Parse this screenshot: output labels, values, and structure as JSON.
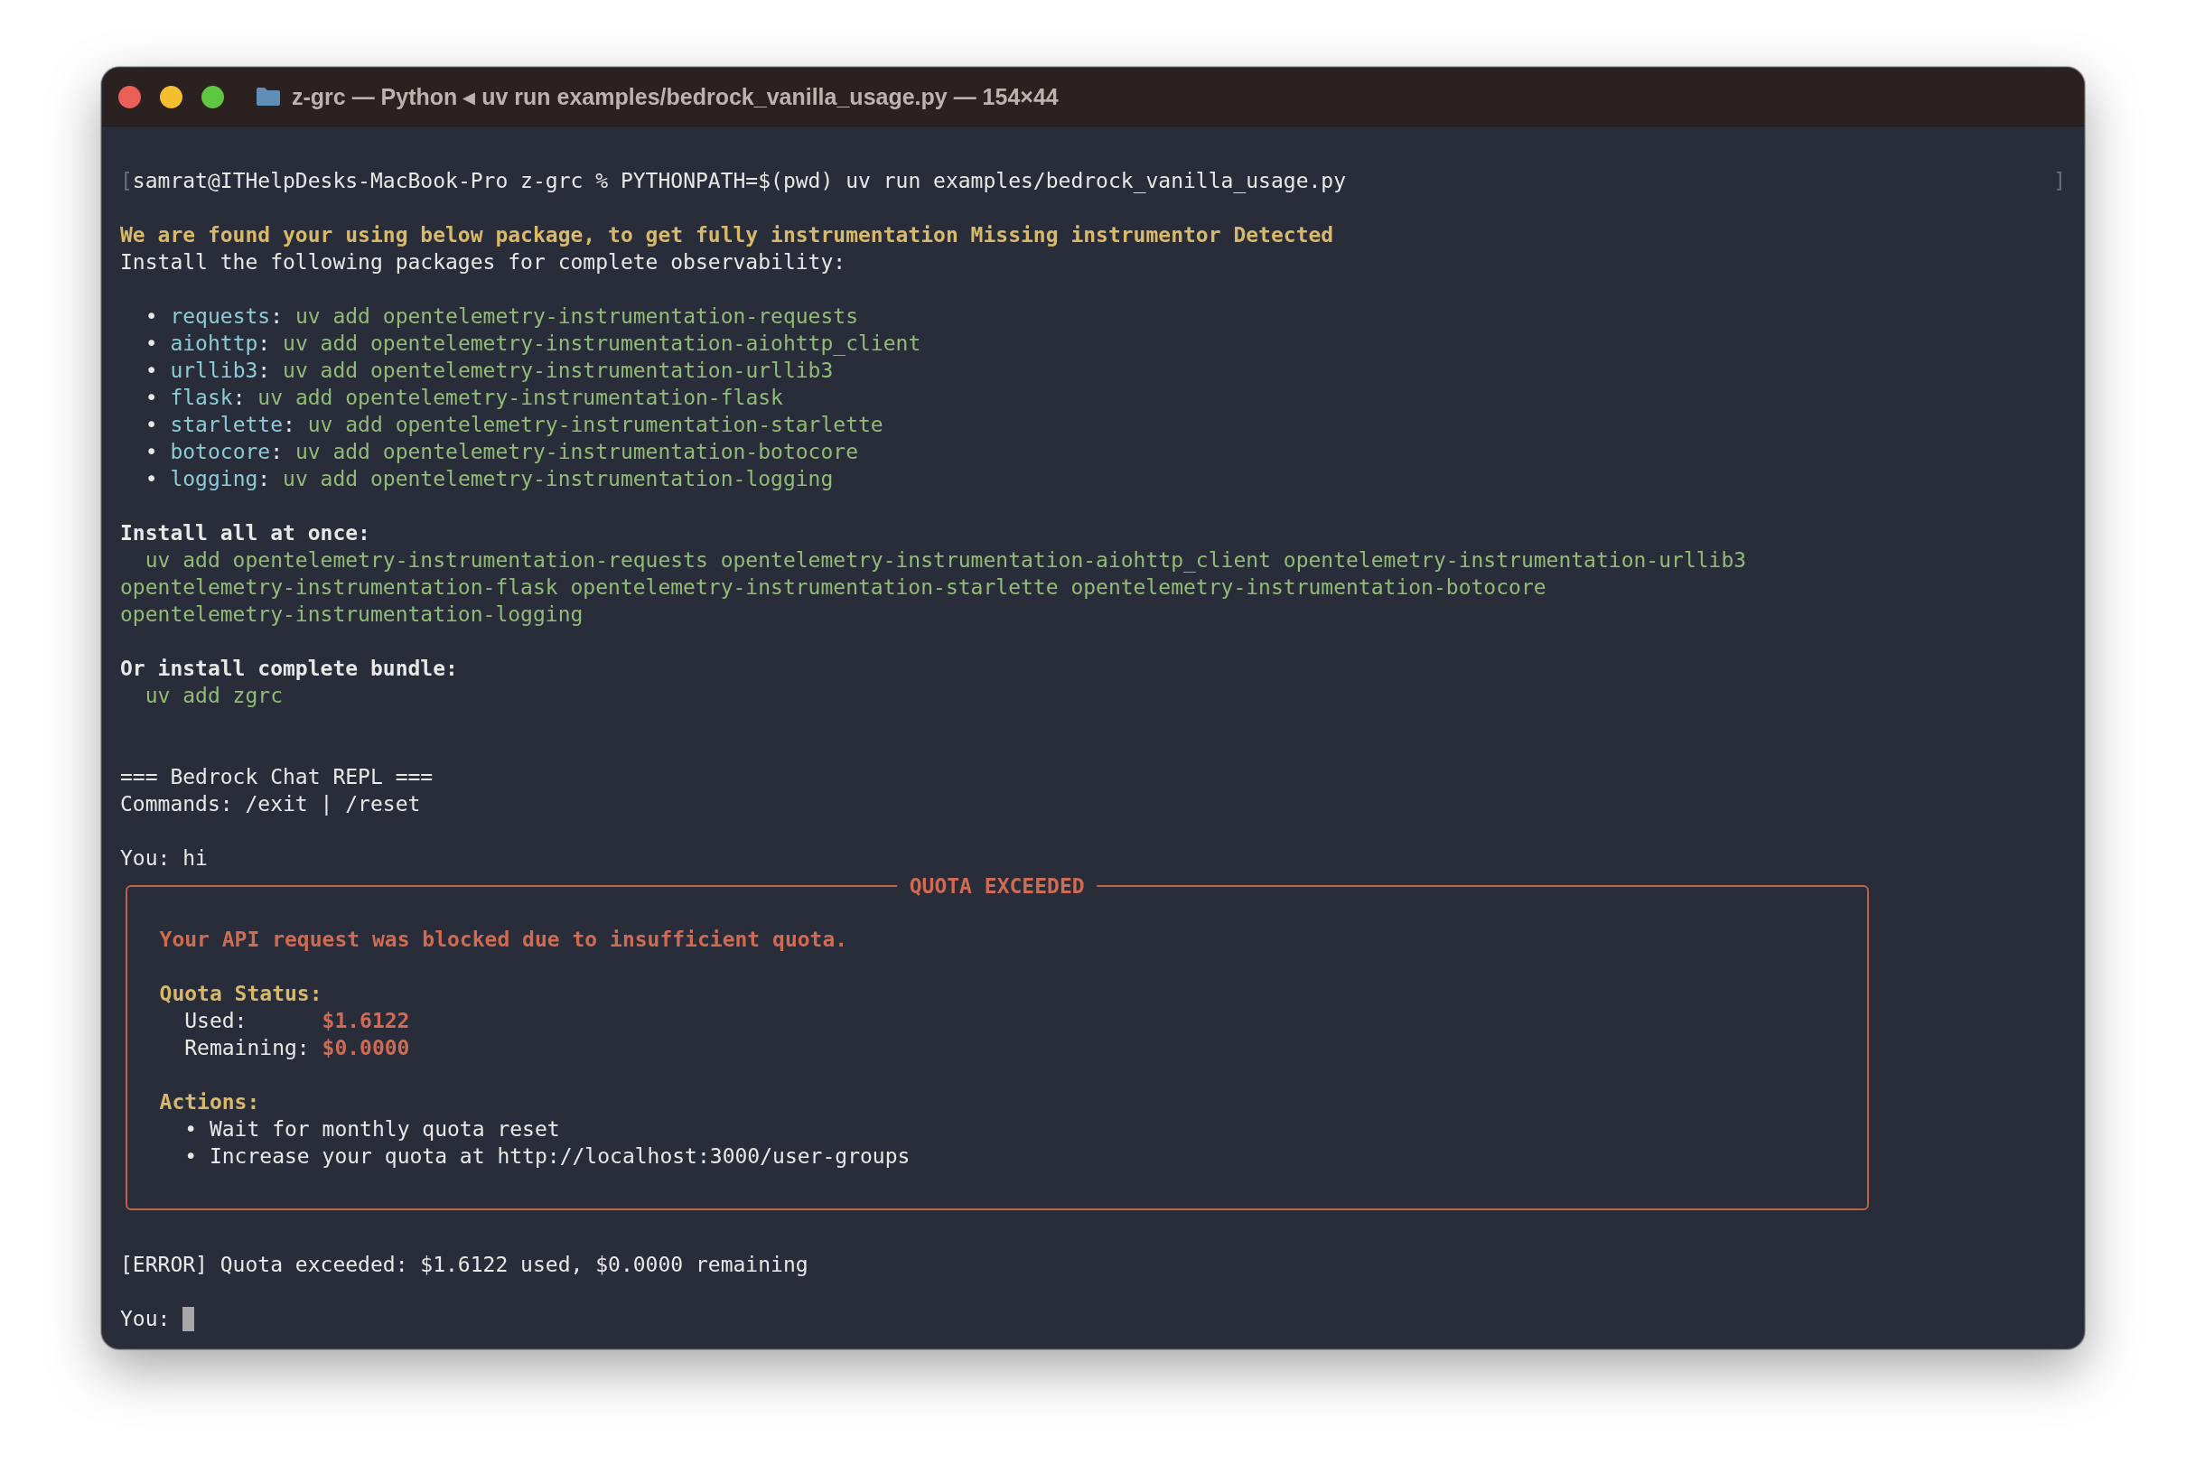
{
  "window": {
    "title": "z-grc — Python ◂ uv run examples/bedrock_vanilla_usage.py — 154×44"
  },
  "prompt": {
    "mark_left": "[",
    "command": "samrat@ITHelpDesks-MacBook-Pro z-grc % PYTHONPATH=$(pwd) uv run examples/bedrock_vanilla_usage.py",
    "mark_right": "]"
  },
  "warning": "We are found your using below package, to get fully instrumentation Missing instrumentor Detected",
  "intro": "Install the following packages for complete observability:",
  "packages": [
    {
      "marker": "•",
      "name": "requests",
      "colon": ":",
      "command": "uv add opentelemetry-instrumentation-requests"
    },
    {
      "marker": "•",
      "name": "aiohttp",
      "colon": ":",
      "command": "uv add opentelemetry-instrumentation-aiohttp_client"
    },
    {
      "marker": "•",
      "name": "urllib3",
      "colon": ":",
      "command": "uv add opentelemetry-instrumentation-urllib3"
    },
    {
      "marker": "•",
      "name": "flask",
      "colon": ":",
      "command": "uv add opentelemetry-instrumentation-flask"
    },
    {
      "marker": "•",
      "name": "starlette",
      "colon": ":",
      "command": "uv add opentelemetry-instrumentation-starlette"
    },
    {
      "marker": "•",
      "name": "botocore",
      "colon": ":",
      "command": "uv add opentelemetry-instrumentation-botocore"
    },
    {
      "marker": "•",
      "name": "logging",
      "colon": ":",
      "command": "uv add opentelemetry-instrumentation-logging"
    }
  ],
  "install_all": {
    "heading": "Install all at once:",
    "lines": [
      {
        "text": "uv add opentelemetry-instrumentation-requests opentelemetry-instrumentation-aiohttp_client opentelemetry-instrumentation-urllib3",
        "indented": true
      },
      {
        "text": "opentelemetry-instrumentation-flask opentelemetry-instrumentation-starlette opentelemetry-instrumentation-botocore",
        "indented": false
      },
      {
        "text": "opentelemetry-instrumentation-logging",
        "indented": false
      }
    ]
  },
  "bundle": {
    "heading": "Or install complete bundle:",
    "lines": [
      {
        "text": "uv add zgrc",
        "indented": true
      }
    ]
  },
  "repl": {
    "banner": "=== Bedrock Chat REPL ===",
    "commands": "Commands: /exit | /reset",
    "user_message": "You: hi"
  },
  "quota_panel": {
    "title": "QUOTA EXCEEDED",
    "message": "Your API request was blocked due to insufficient quota.",
    "status_heading": "Quota Status:",
    "status": [
      {
        "label": "Used:",
        "value": "$1.6122"
      },
      {
        "label": "Remaining:",
        "value": "$0.0000"
      }
    ],
    "actions_heading": "Actions:",
    "actions": [
      {
        "marker": "•",
        "text": "Wait for monthly quota reset"
      },
      {
        "marker": "•",
        "text": "Increase your quota at http://localhost:3000/user-groups"
      }
    ]
  },
  "error": "[ERROR] Quota exceeded: $1.6122 used, $0.0000 remaining",
  "input_prompt": "You:"
}
